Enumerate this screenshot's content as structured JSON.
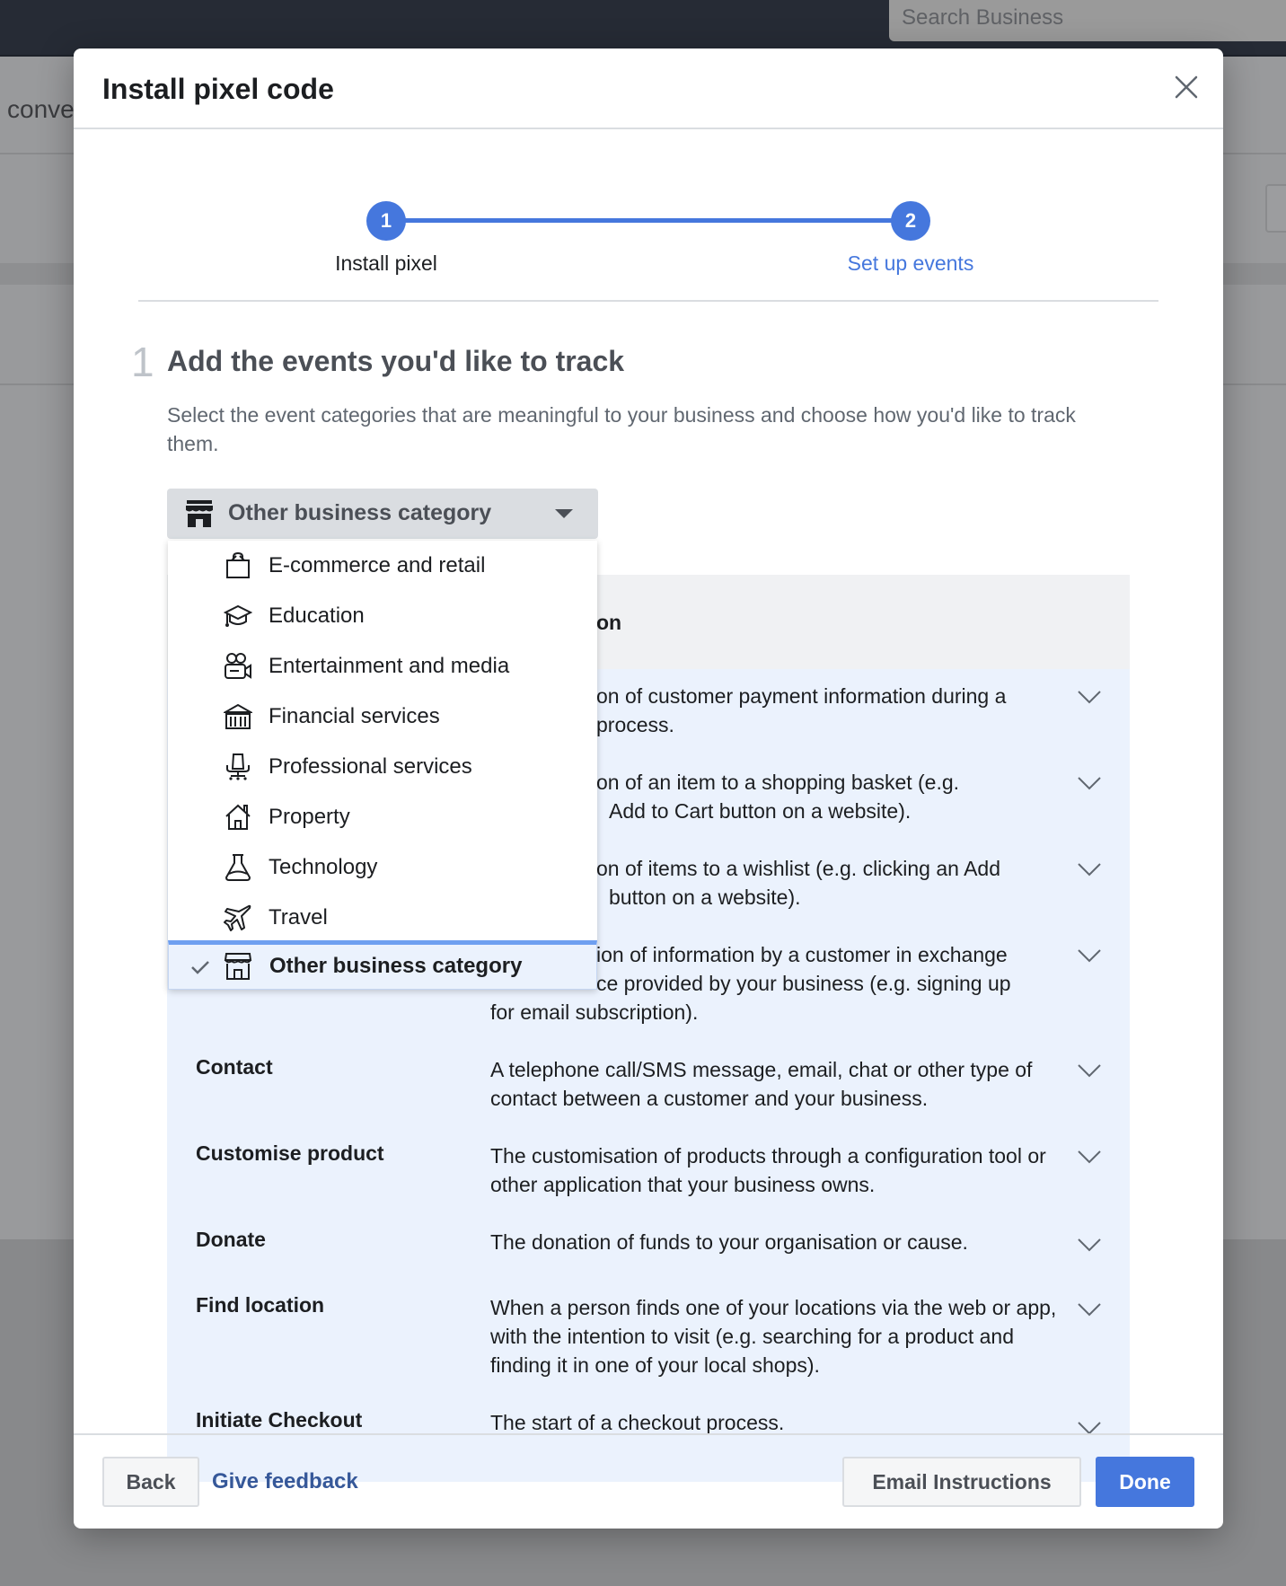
{
  "background": {
    "search_placeholder": "Search Business",
    "partial_text": "conve"
  },
  "modal": {
    "title": "Install pixel code",
    "close_icon": "close-icon"
  },
  "stepper": {
    "steps": [
      {
        "number": "1",
        "label": "Install pixel",
        "state": "completed"
      },
      {
        "number": "2",
        "label": "Set up events",
        "state": "active"
      }
    ],
    "accent_color": "#4577dd"
  },
  "section": {
    "number": "1",
    "heading": "Add the events you'd like to track",
    "description": "Select the event categories that are meaningful to your business and choose how you'd like to track them."
  },
  "category_dropdown": {
    "selected": "Other business category",
    "selected_icon": "store-icon",
    "options": [
      {
        "label": "E-commerce and retail",
        "icon": "shopping-bag-icon"
      },
      {
        "label": "Education",
        "icon": "graduation-cap-icon"
      },
      {
        "label": "Entertainment and media",
        "icon": "video-camera-icon"
      },
      {
        "label": "Financial services",
        "icon": "bank-icon"
      },
      {
        "label": "Professional services",
        "icon": "office-chair-icon"
      },
      {
        "label": "Property",
        "icon": "house-icon"
      },
      {
        "label": "Technology",
        "icon": "flask-icon"
      },
      {
        "label": "Travel",
        "icon": "airplane-icon"
      },
      {
        "label": "Other business category",
        "icon": "store-icon",
        "selected": true
      }
    ]
  },
  "events_table": {
    "header_partial": "on",
    "rows": [
      {
        "name": "",
        "description": "on of customer payment information during a",
        "description2": "process.",
        "partial": true
      },
      {
        "name": "",
        "description": "on of an item to a shopping basket (e.g.",
        "description2": "Add to Cart button on a website).",
        "partial": true
      },
      {
        "name": "",
        "description": "on of items to a wishlist (e.g. clicking an Add",
        "description2": "button on a website).",
        "partial": true
      },
      {
        "name": "",
        "description": "ion of information by a customer in exchange",
        "description2": "ce provided by your business (e.g. signing up",
        "description3": "for email subscription).",
        "partial": true
      },
      {
        "name": "Contact",
        "description": "A telephone call/SMS message, email, chat or other type of contact between a customer and your business."
      },
      {
        "name": "Customise product",
        "description": "The customisation of products through a configuration tool or other application that your business owns."
      },
      {
        "name": "Donate",
        "description": "The donation of funds to your organisation or cause."
      },
      {
        "name": "Find location",
        "description": "When a person finds one of your locations via the web or app, with the intention to visit (e.g. searching for a product and finding it in one of your local shops)."
      },
      {
        "name": "Initiate Checkout",
        "description": "The start of a checkout process."
      }
    ]
  },
  "footer": {
    "back_label": "Back",
    "feedback_label": "Give feedback",
    "email_label": "Email Instructions",
    "done_label": "Done"
  }
}
